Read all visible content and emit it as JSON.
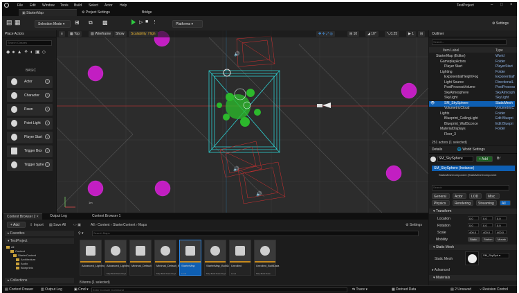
{
  "menubar": {
    "items": [
      "File",
      "Edit",
      "Window",
      "Tools",
      "Build",
      "Select",
      "Actor",
      "Help"
    ],
    "project": "TestProject"
  },
  "tabs": [
    {
      "label": "StarterMap"
    },
    {
      "label": "Project Settings"
    },
    {
      "label": "Bridge"
    }
  ],
  "toolbar": {
    "selection_mode": "Selection Mode",
    "platforms": "Platforms",
    "settings": "Settings"
  },
  "place_actors": {
    "title": "Place Actors",
    "search_placeholder": "Search Classes",
    "category": "BASIC",
    "items": [
      {
        "label": "Actor"
      },
      {
        "label": "Character"
      },
      {
        "label": "Pawn"
      },
      {
        "label": "Point Light"
      },
      {
        "label": "Player Start"
      },
      {
        "label": "Trigger Box"
      },
      {
        "label": "Trigger Sphe"
      }
    ]
  },
  "viewport": {
    "top": "Top",
    "wireframe": "Wireframe",
    "show": "Show",
    "scalability": "Scalability: High",
    "grid": "10",
    "angle": "10°",
    "scale": "0.25",
    "cam": "1",
    "scale_bar": "1m"
  },
  "outliner": {
    "title": "Outliner",
    "search_placeholder": "Search...",
    "col_label": "Item Label",
    "col_type": "Type",
    "rows": [
      {
        "name": "StarterMap (Editor)",
        "type": "World",
        "indent": 10
      },
      {
        "name": "GameplayActors",
        "type": "Folder",
        "indent": 16
      },
      {
        "name": "Player Start",
        "type": "PlayerStart",
        "indent": 22
      },
      {
        "name": "Lighting",
        "type": "Folder",
        "indent": 16
      },
      {
        "name": "ExponentialHeightFog",
        "type": "ExponentialH",
        "indent": 22
      },
      {
        "name": "Light Source",
        "type": "DirectionalL",
        "indent": 22
      },
      {
        "name": "PostProcessVolume",
        "type": "PostProcess",
        "indent": 22
      },
      {
        "name": "SkyAtmosphere",
        "type": "SkyAtmosph",
        "indent": 22
      },
      {
        "name": "SkyLight",
        "type": "SkyLight",
        "indent": 22
      },
      {
        "name": "SM_SkySphere",
        "type": "StaticMesh",
        "indent": 22,
        "selected": true
      },
      {
        "name": "VolumetricCloud",
        "type": "VolumetricC",
        "indent": 22
      },
      {
        "name": "Lights",
        "type": "Folder",
        "indent": 16
      },
      {
        "name": "Blueprint_CeilingLight",
        "type": "Edit Bluepri",
        "indent": 22
      },
      {
        "name": "Blueprint_WallSconce",
        "type": "Edit Bluepri",
        "indent": 22
      },
      {
        "name": "MaterialDisplays",
        "type": "Folder",
        "indent": 16
      },
      {
        "name": "Floor_3",
        "type": "",
        "indent": 22
      }
    ],
    "count": "251 actors (1 selected)"
  },
  "details": {
    "tab1": "Details",
    "tab2": "World Settings",
    "actor": "SM_SkySphere",
    "add": "Add",
    "instance": "SM_SkySphere (Instance)",
    "component": "StaticMeshComponent (StaticMeshComponent",
    "search_placeholder": "Search",
    "filters1": [
      "General",
      "Actor",
      "LOD",
      "Misc"
    ],
    "filters2": [
      "Physics",
      "Rendering",
      "Streaming",
      "All"
    ],
    "transform": "Transform",
    "location": "Location",
    "rotation": "Rotation",
    "scale": "Scale",
    "loc": [
      "0.0",
      "0.0",
      "0.0"
    ],
    "rot": [
      "0.0",
      "0.0",
      "0.0"
    ],
    "scl": [
      "400.0",
      "400.0",
      "400.0"
    ],
    "mobility": "Mobility",
    "mob_opts": [
      "Static",
      "Station",
      "Movab"
    ],
    "static_mesh_section": "Static Mesh",
    "static_mesh_label": "Static Mesh",
    "mesh_value": "SM_SkySph",
    "advanced": "Advanced",
    "materials": "Materials"
  },
  "content_browser": {
    "tab1": "Content Browser 2",
    "tab2": "Output Log",
    "tab3": "Content Browser 1",
    "add": "Add",
    "import": "Import",
    "save_all": "Save All",
    "path": [
      "All",
      "Content",
      "StarterContent",
      "Maps"
    ],
    "settings": "Settings",
    "favorites": "Favorites",
    "project": "TestProject",
    "tree": [
      "All",
      "Content",
      "StarterContent",
      "Architecture",
      "Audio",
      "Blueprints"
    ],
    "search_placeholder": "Search Maps",
    "collections": "Collections",
    "status": "8 items (1 selected)",
    "assets": [
      {
        "label": "Advanced_Lighting",
        "sub": ""
      },
      {
        "label": "Advanced_Lighting_Built",
        "sub": "Map Build Data Regis"
      },
      {
        "label": "Minimal_Default",
        "sub": ""
      },
      {
        "label": "Minimal_Default_Built",
        "sub": "Map Build Data Regis"
      },
      {
        "label": "StarterMap",
        "sub": "Level",
        "selected": true
      },
      {
        "label": "StarterMap_BuiltData",
        "sub": "Map Build Data Regis"
      },
      {
        "label": "Unrolled",
        "sub": "Level"
      },
      {
        "label": "Unrolled_BuiltData",
        "sub": "Map Build Data"
      }
    ]
  },
  "statusbar": {
    "drawer": "Content Drawer",
    "output": "Output Log",
    "cmd": "Cmd",
    "cmd_placeholder": "Enter Console Command",
    "trace": "Trace",
    "derived": "Derived Data",
    "unsaved": "2 Unsaved",
    "revision": "Revision Control"
  },
  "colors": {
    "accent": "#0e5fb3",
    "wire_cyan": "#2ecfd0",
    "wire_red": "#d33030",
    "purple": "#c21ec2",
    "green": "#2cb82c"
  }
}
